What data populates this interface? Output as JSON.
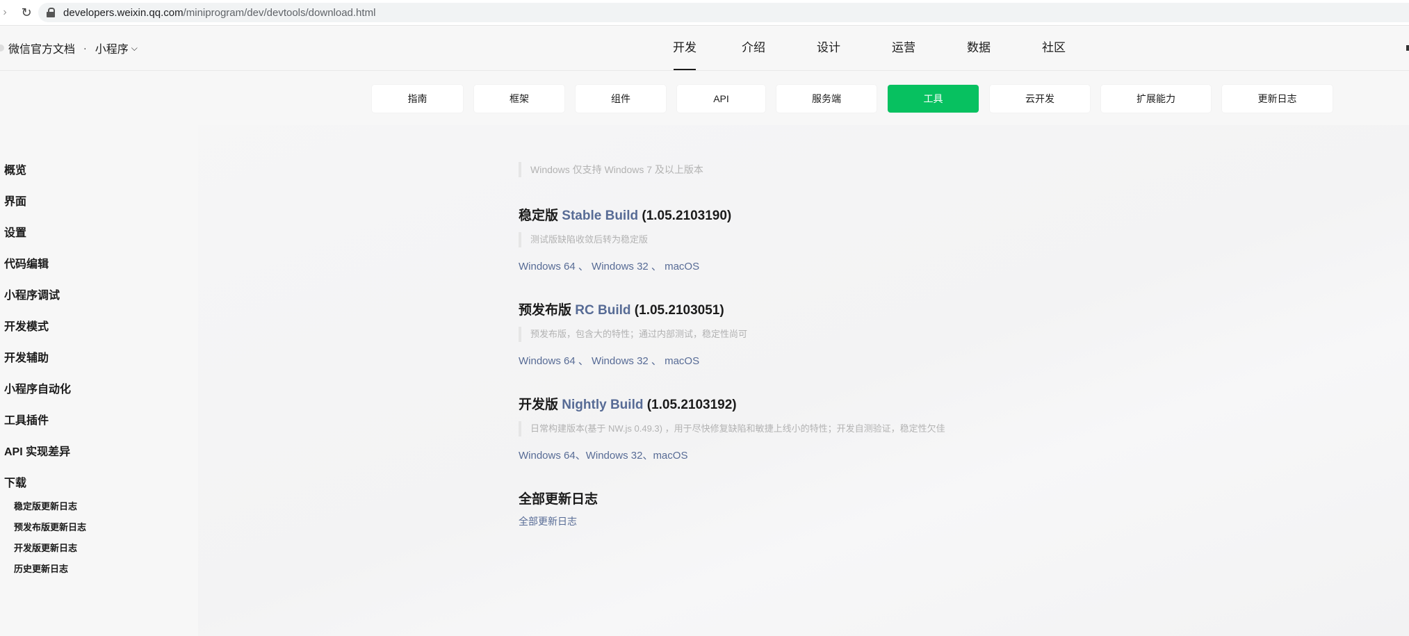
{
  "browser": {
    "url_host": "developers.weixin.qq.com",
    "url_path": "/miniprogram/dev/devtools/download.html"
  },
  "header": {
    "brand": "微信官方文档",
    "separator": "·",
    "product": "小程序",
    "nav": [
      "开发",
      "介绍",
      "设计",
      "运营",
      "数据",
      "社区"
    ]
  },
  "subnav": {
    "tabs": [
      "指南",
      "框架",
      "组件",
      "API",
      "服务端",
      "工具",
      "云开发",
      "扩展能力",
      "更新日志"
    ],
    "active": "工具"
  },
  "sidebar": {
    "items": [
      "概览",
      "界面",
      "设置",
      "代码编辑",
      "小程序调试",
      "开发模式",
      "开发辅助",
      "小程序自动化",
      "工具插件",
      "API 实现差异",
      "下载"
    ],
    "sub_items": [
      "稳定版更新日志",
      "预发布版更新日志",
      "开发版更新日志",
      "历史更新日志"
    ]
  },
  "content": {
    "windows_note": "Windows 仅支持 Windows 7 及以上版本",
    "stable": {
      "prefix": "稳定版",
      "build": "Stable Build",
      "version": "(1.05.2103190)",
      "note": "测试版缺陷收敛后转为稳定版",
      "links": [
        "Windows 64",
        "Windows 32",
        "macOS"
      ],
      "sep": " 、 "
    },
    "rc": {
      "prefix": "预发布版",
      "build": "RC Build",
      "version": "(1.05.2103051)",
      "note": "预发布版，包含大的特性；通过内部测试，稳定性尚可",
      "links": [
        "Windows 64",
        "Windows 32",
        "macOS"
      ],
      "sep": " 、 "
    },
    "nightly": {
      "prefix": "开发版",
      "build": "Nightly Build",
      "version": "(1.05.2103192)",
      "note": "日常构建版本(基于 NW.js 0.49.3) ，用于尽快修复缺陷和敏捷上线小的特性；开发自测验证，稳定性欠佳",
      "links": [
        "Windows 64",
        "Windows 32",
        "macOS"
      ],
      "sep": "、"
    },
    "all_changelog_heading": "全部更新日志",
    "all_changelog_link": "全部更新日志"
  },
  "colors": {
    "accent_green": "#07c160",
    "link_blue": "#576b95"
  }
}
